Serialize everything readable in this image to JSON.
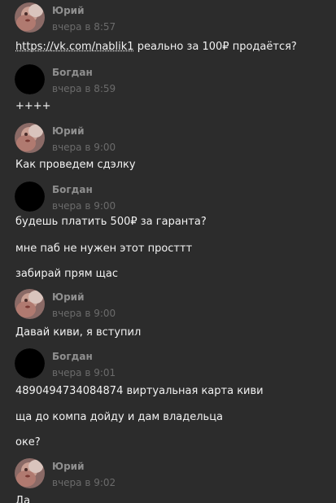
{
  "messages": [
    {
      "author": "Юрий",
      "avatar": "photo-avatar-icon",
      "time": "вчера в 8:57",
      "lines": [
        {
          "link": "https://vk.com/nablik1",
          "text": " реально за 100₽ продаётся?"
        }
      ]
    },
    {
      "author": "Богдан",
      "avatar": "black-avatar-icon",
      "time": "вчера в 8:59",
      "lines": [
        {
          "text": "++++"
        }
      ]
    },
    {
      "author": "Юрий",
      "avatar": "photo-avatar-icon",
      "time": "вчера в 9:00",
      "lines": [
        {
          "text": "Как проведем сдэлку"
        }
      ]
    },
    {
      "author": "Богдан",
      "avatar": "black-avatar-icon",
      "time": "вчера в 9:00",
      "lines": [
        {
          "text": "будешь платить 500₽ за гаранта?"
        },
        {
          "text": "мне паб не нужен этот просттт"
        },
        {
          "text": "забирай прям щас"
        }
      ]
    },
    {
      "author": "Юрий",
      "avatar": "photo-avatar-icon",
      "time": "вчера в 9:00",
      "lines": [
        {
          "text": "Давай киви, я вступил"
        }
      ]
    },
    {
      "author": "Богдан",
      "avatar": "black-avatar-icon",
      "time": "вчера в 9:01",
      "lines": [
        {
          "text": "4890494734084874 виртуальная карта киви"
        },
        {
          "text": "ща до компа дойду и дам владельца"
        },
        {
          "text": "оке?"
        }
      ]
    },
    {
      "author": "Юрий",
      "avatar": "photo-avatar-icon",
      "time": "вчера в 9:02",
      "lines": [
        {
          "text": "Да"
        }
      ]
    }
  ],
  "colors": {
    "background": "#2c2c2c",
    "author": "#8f8f8f",
    "time": "#6b6b6b",
    "text": "#f2f2f2"
  }
}
